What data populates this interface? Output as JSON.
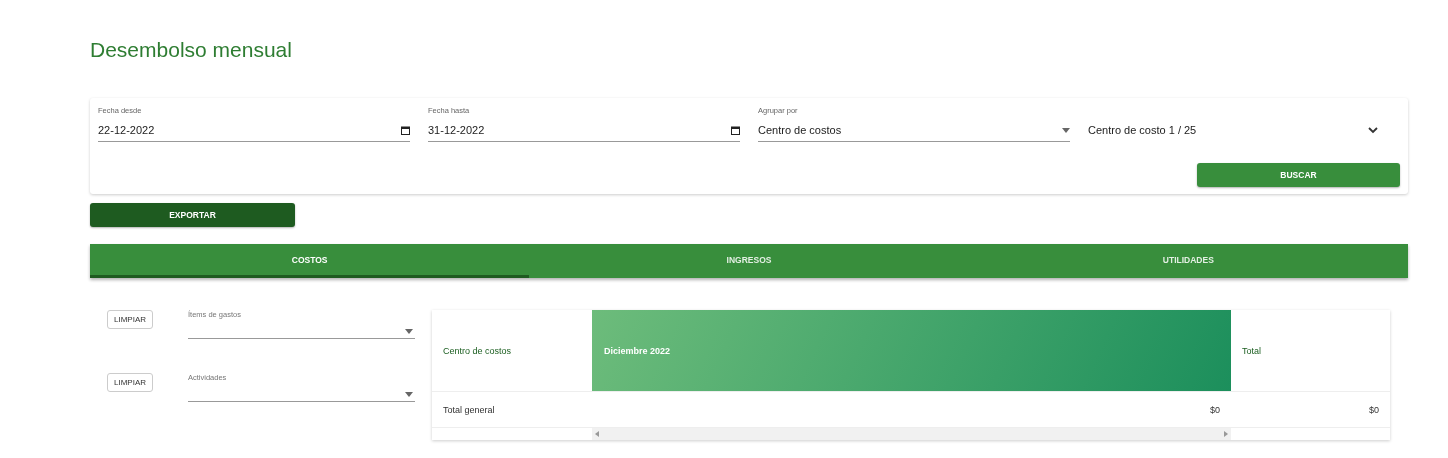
{
  "title": "Desembolso mensual",
  "filters": [
    {
      "kind": "date",
      "label": "Fecha desde",
      "value": "22-12-2022"
    },
    {
      "kind": "date",
      "label": "Fecha hasta",
      "value": "31-12-2022"
    },
    {
      "kind": "select",
      "label": "Agrupar por",
      "value": "Centro de costos"
    },
    {
      "kind": "multiselect",
      "value": "Centro de costo 1 / 25"
    }
  ],
  "search_button": "BUSCAR",
  "export_button": "EXPORTAR",
  "tabs": [
    {
      "label": "COSTOS",
      "selected": true
    },
    {
      "label": "INGRESOS",
      "selected": false
    },
    {
      "label": "UTILIDADES",
      "selected": false
    }
  ],
  "side_filters": [
    {
      "button": "LIMPIAR",
      "label": "Ítems de gastos"
    },
    {
      "button": "LIMPIAR",
      "label": "Actividades"
    }
  ],
  "table": {
    "columns": [
      "Centro de costos",
      "Diciembre 2022",
      "Total"
    ],
    "rows": [
      [
        "Total general",
        "$0",
        "$0"
      ]
    ]
  }
}
